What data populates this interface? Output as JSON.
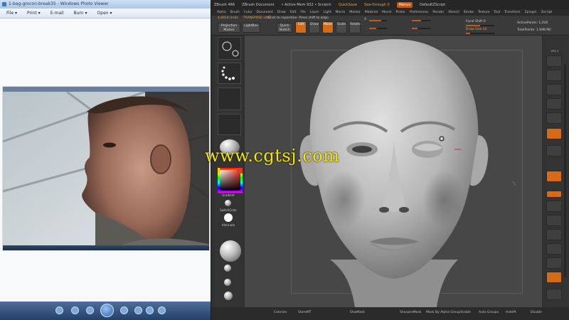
{
  "photo_viewer": {
    "window_title": "1-bag-gmcon-break35 - Windows Photo Viewer",
    "menu": [
      {
        "label": "File ▾"
      },
      {
        "label": "Print ▾"
      },
      {
        "label": "E-mail"
      },
      {
        "label": "Burn ▾"
      },
      {
        "label": "Open ▾"
      }
    ]
  },
  "zbrush": {
    "title": {
      "app": "ZBrush 4R6",
      "doc": "ZBrush Document",
      "mem": "• Active Mem 932 • Scratch",
      "quicksave": "QuickSave",
      "seethrough": "See-through  0",
      "menus": "Menus",
      "script": "DefaultZScript"
    },
    "menu": [
      "Alpha",
      "Brush",
      "Color",
      "Document",
      "Draw",
      "Edit",
      "File",
      "Layer",
      "Light",
      "Macro",
      "Marker",
      "Material",
      "Movie",
      "Picker",
      "Preferences",
      "Render",
      "Stencil",
      "Stroke",
      "Texture",
      "Tool",
      "Transform",
      "Zplugin",
      "Zscript"
    ],
    "shelf": {
      "projection_master": "Projection Master",
      "lightbox": "LightBox",
      "quick_sketch": "Quick Sketch",
      "edit": "Edit",
      "draw": "Draw",
      "move": "Move",
      "scale": "Scale",
      "rotate": "Rotate",
      "units": "4.6814 Units",
      "transpose": "TRANSPOSE LINE",
      "hint": "Click to reposition. Press shift to align.",
      "focal_shift": "Focal Shift 0",
      "draw_size": "Draw Size 24",
      "active_points": "ActivePoints: 1,026",
      "total_points": "TotalPoints: 1.698 Mil"
    },
    "left_tray": {
      "gradient": "Gradient",
      "switch_color": "SwitchColor",
      "alternate": "Alternate"
    },
    "color": {
      "picker": "#e7342c"
    },
    "bottom": [
      "Colorize",
      "StoreMT",
      "ShwMask",
      "SharpenMask",
      "Mask By Alpha GroupVisible",
      "Auto Groups",
      "HidePt",
      "Double"
    ]
  },
  "watermark": {
    "text": "www.cgtsj.com"
  }
}
